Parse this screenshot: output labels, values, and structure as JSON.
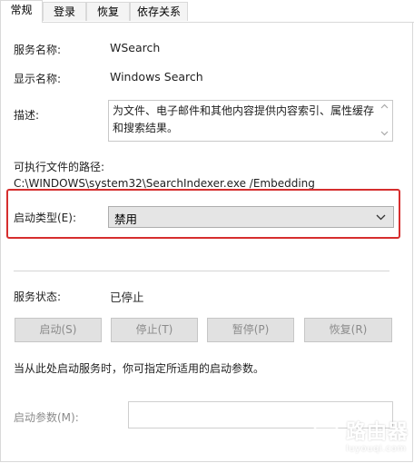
{
  "tabs": [
    {
      "label": "常规",
      "active": true
    },
    {
      "label": "登录",
      "active": false
    },
    {
      "label": "恢复",
      "active": false
    },
    {
      "label": "依存关系",
      "active": false
    }
  ],
  "service_name": {
    "label": "服务名称:",
    "value": "WSearch"
  },
  "display_name": {
    "label": "显示名称:",
    "value": "Windows Search"
  },
  "description": {
    "label": "描述:",
    "value": "为文件、电子邮件和其他内容提供内容索引、属性缓存和搜索结果。"
  },
  "exe_path": {
    "label": "可执行文件的路径:",
    "value": "C:\\WINDOWS\\system32\\SearchIndexer.exe /Embedding"
  },
  "startup_type": {
    "label": "启动类型(E):",
    "selected": "禁用"
  },
  "service_status": {
    "label": "服务状态:",
    "value": "已停止"
  },
  "buttons": {
    "start": "启动(S)",
    "stop": "停止(T)",
    "pause": "暂停(P)",
    "resume": "恢复(R)"
  },
  "hint": "当从此处启动服务时，你可指定所适用的启动参数。",
  "start_params": {
    "label": "启动参数(M):",
    "value": ""
  },
  "watermark": {
    "title": "路由器",
    "subtitle": "luyouqi.com"
  },
  "colors": {
    "highlight": "#d62e2e",
    "disabled_text": "#8b8b8b"
  }
}
